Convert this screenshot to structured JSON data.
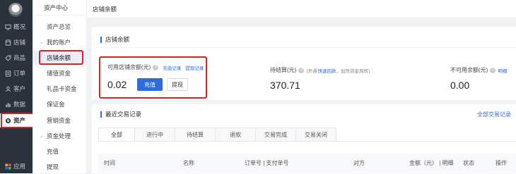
{
  "sidebar": {
    "items": [
      {
        "label": "概况",
        "icon": "monitor-icon"
      },
      {
        "label": "店铺",
        "icon": "shop-icon"
      },
      {
        "label": "商品",
        "icon": "tag-icon"
      },
      {
        "label": "订单",
        "icon": "list-icon"
      },
      {
        "label": "客户",
        "icon": "user-icon"
      },
      {
        "label": "数据",
        "icon": "chart-icon"
      },
      {
        "label": "资产",
        "icon": "asset-icon"
      },
      {
        "label": "应用",
        "icon": "apps-icon"
      }
    ]
  },
  "subnav": {
    "header": "资产中心",
    "overview": "资产总览",
    "my_account": "我的账户",
    "shop_balance": "店铺余额",
    "deposit": "储值资金",
    "gift_card": "礼品卡资金",
    "guarantee": "保证金",
    "marketing": "营销资金",
    "fund_processing": "资金处理",
    "recharge": "充值",
    "withdraw": "提现"
  },
  "header": {
    "title": "店铺余额"
  },
  "balance_section": {
    "title": "店铺余额",
    "available": {
      "label": "可用店铺余额(元)",
      "recharge_record": "充值记录",
      "withdraw_record": "提现记录",
      "value": "0.02",
      "recharge_btn": "充值",
      "withdraw_btn": "提现"
    },
    "pending": {
      "label": "待结算(元)",
      "note_prefix": "(开通",
      "note_link": "快速回款",
      "note_suffix": "，加快资金周转)",
      "value": "370.71"
    },
    "unavailable": {
      "label": "不可用余额(元)",
      "detail_link": "明细",
      "value": "0.00"
    }
  },
  "transactions": {
    "title": "最近交易记录",
    "all_records": "全部交易记录",
    "tabs": [
      "全部",
      "进行中",
      "待结算",
      "退款",
      "交易完成",
      "交易关闭"
    ],
    "columns": [
      "时间",
      "名称",
      "订单号 | 支付单号",
      "对方",
      "金额（元） | 明细",
      "状态",
      "操作"
    ]
  },
  "colors": {
    "accent": "#2f6bdc",
    "highlight": "#e02020",
    "sidebar_bg": "#2c323b"
  }
}
